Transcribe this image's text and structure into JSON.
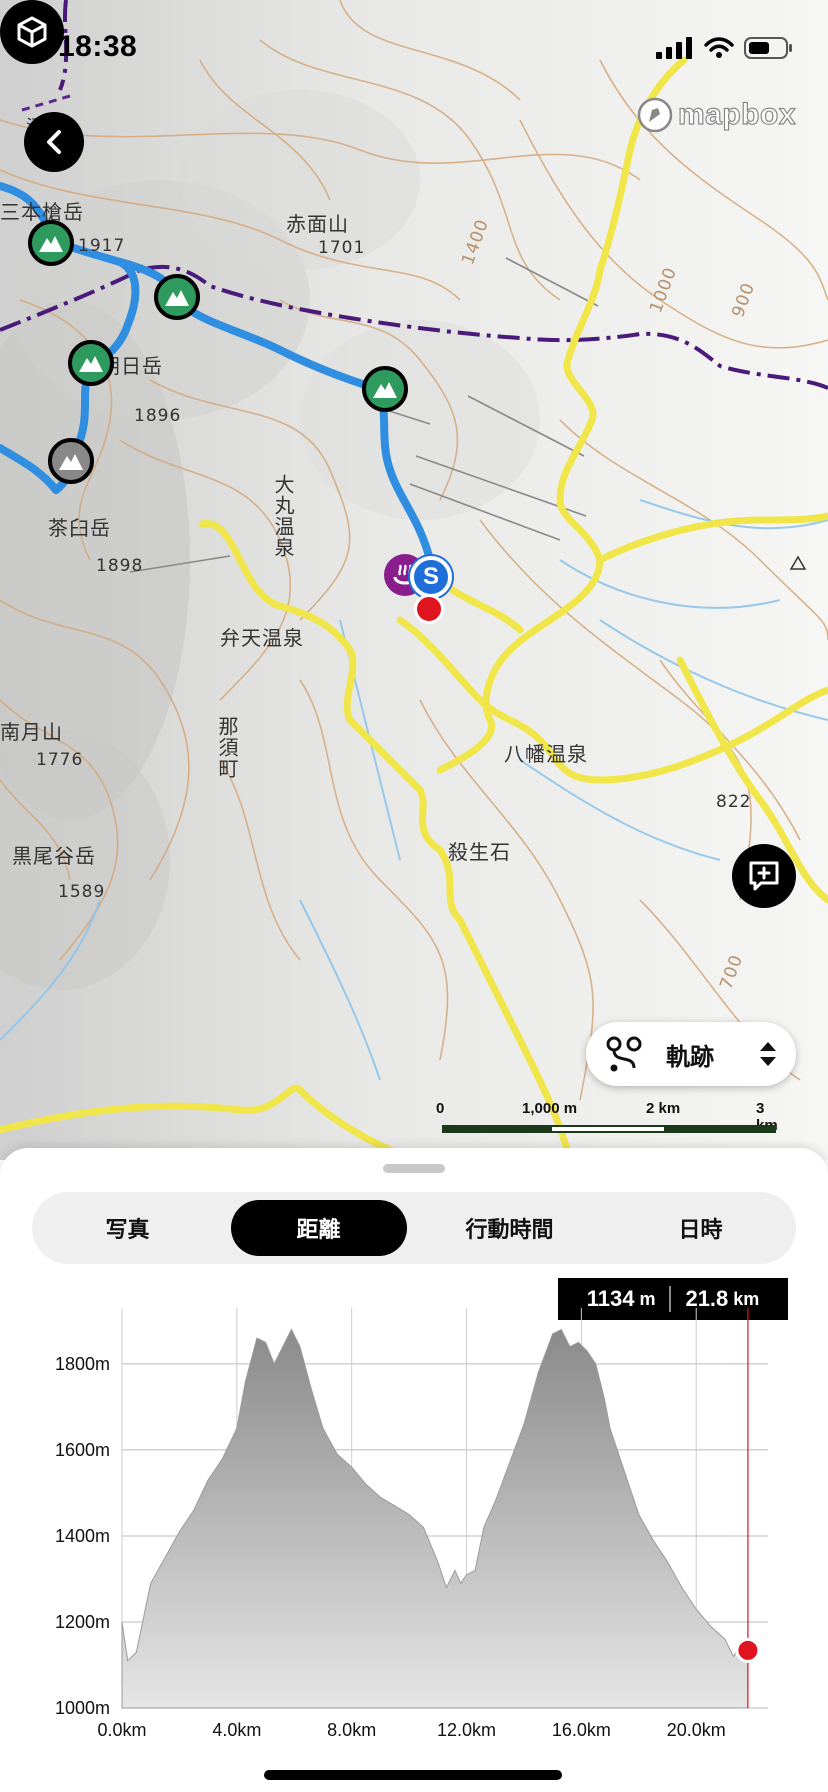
{
  "status_bar": {
    "time": "18:38"
  },
  "map": {
    "attribution": "mapbox",
    "labels": {
      "peak_sanbon": "三本槍岳",
      "elev_1917": "1917",
      "peak_akazura": "赤面山",
      "elev_1701": "1701",
      "peak_asahi": "朝日岳",
      "elev_1896": "1896",
      "peak_chausu": "茶臼岳",
      "elev_1898": "1898",
      "peak_minamigassan": "南月山",
      "elev_1776": "1776",
      "peak_kurooya": "黒尾谷岳",
      "elev_1589": "1589",
      "onsen_omaru": "大丸温泉",
      "onsen_benten": "弁天温泉",
      "town_nasu": "那須町",
      "onsen_yawata": "八幡温泉",
      "place_sessho": "殺生石",
      "elev_822": "822",
      "contour_1400": "1400",
      "contour_1000": "1000",
      "contour_900": "900",
      "contour_700": "700",
      "pond": "沼"
    },
    "track_toggle": {
      "label": "軌跡",
      "icon": "route-icon"
    },
    "scale": {
      "ticks": [
        "0",
        "1,000 m",
        "2 km",
        "3 km"
      ]
    }
  },
  "sheet": {
    "tabs": [
      {
        "label": "写真",
        "active": false
      },
      {
        "label": "距離",
        "active": true
      },
      {
        "label": "行動時間",
        "active": false
      },
      {
        "label": "日時",
        "active": false
      }
    ],
    "readout": {
      "elevation": "1134",
      "elevation_unit": "m",
      "distance": "21.8",
      "distance_unit": "km"
    }
  },
  "chart_data": {
    "type": "area",
    "title": "",
    "xlabel": "",
    "ylabel": "",
    "x_unit": "km",
    "y_unit": "m",
    "xlim": [
      0,
      22.5
    ],
    "ylim": [
      1000,
      1930
    ],
    "x_ticks": [
      "0.0km",
      "4.0km",
      "8.0km",
      "12.0km",
      "16.0km",
      "20.0km"
    ],
    "y_ticks": [
      "1000m",
      "1200m",
      "1400m",
      "1600m",
      "1800m"
    ],
    "x": [
      0,
      0.2,
      0.5,
      1,
      1.5,
      2,
      2.5,
      3,
      3.5,
      4,
      4.3,
      4.7,
      5,
      5.3,
      5.6,
      5.9,
      6.2,
      6.6,
      7,
      7.5,
      8,
      8.5,
      9,
      9.5,
      10,
      10.5,
      11,
      11.3,
      11.6,
      11.8,
      12,
      12.3,
      12.6,
      13,
      13.5,
      14,
      14.5,
      15,
      15.3,
      15.6,
      15.9,
      16.2,
      16.5,
      16.8,
      17,
      17.5,
      18,
      18.5,
      19,
      19.5,
      20,
      20.5,
      21,
      21.3,
      21.6,
      21.8
    ],
    "y": [
      1200,
      1110,
      1130,
      1290,
      1350,
      1410,
      1460,
      1530,
      1580,
      1650,
      1760,
      1860,
      1850,
      1800,
      1840,
      1880,
      1840,
      1740,
      1650,
      1590,
      1560,
      1520,
      1490,
      1470,
      1450,
      1420,
      1340,
      1280,
      1320,
      1290,
      1310,
      1320,
      1420,
      1480,
      1570,
      1660,
      1780,
      1870,
      1880,
      1840,
      1850,
      1830,
      1800,
      1720,
      1650,
      1550,
      1450,
      1390,
      1340,
      1280,
      1230,
      1190,
      1160,
      1120,
      1150,
      1134
    ],
    "marker": {
      "x": 21.8,
      "y": 1134
    },
    "grid": true,
    "legend": "none"
  }
}
